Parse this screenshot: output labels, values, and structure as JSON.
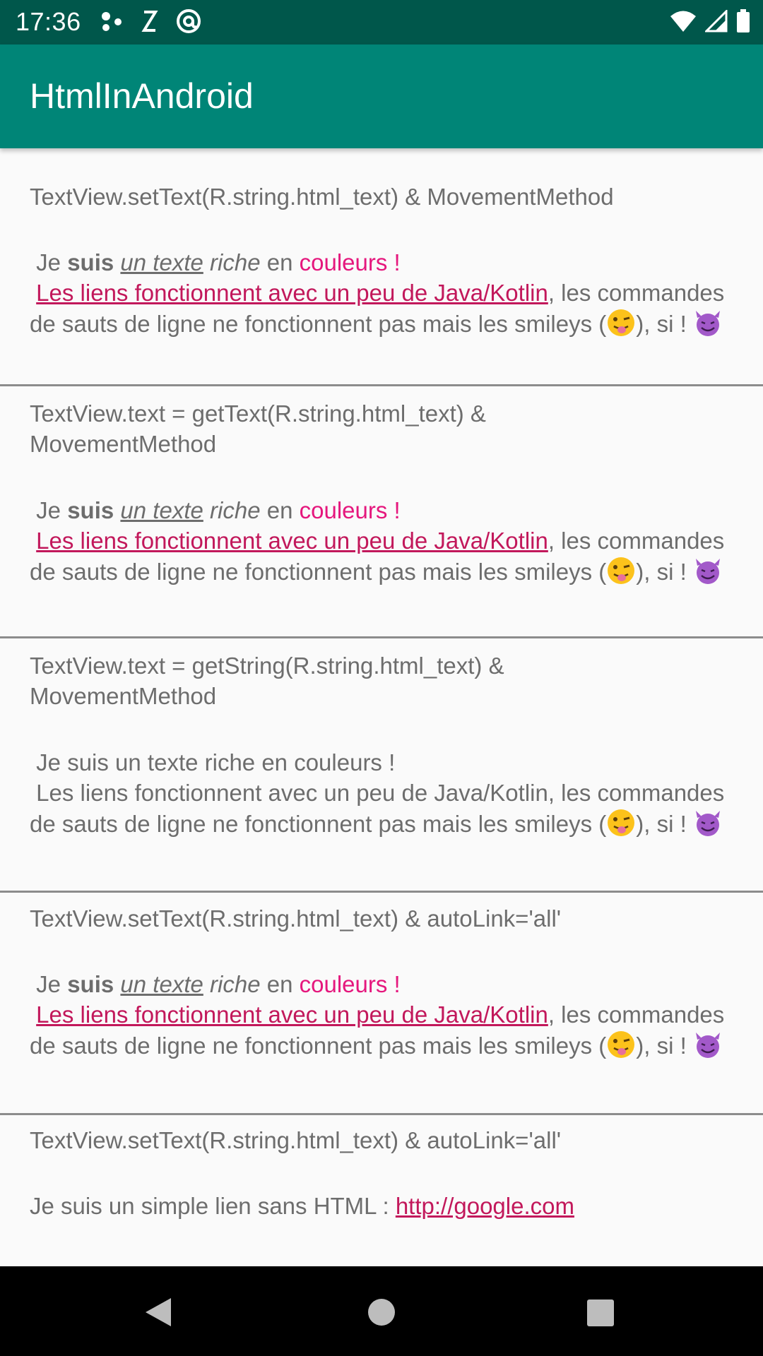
{
  "status_bar": {
    "time": "17:36"
  },
  "app_bar": {
    "title": "HtmlInAndroid"
  },
  "sections": [
    {
      "title": "TextView.setText(R.string.html_text) & MovementMethod",
      "line1": {
        "je": "Je",
        "suis": "suis",
        "un_texte": "un texte",
        "riche": "riche",
        "en": "en",
        "couleurs": "couleurs !"
      },
      "link_text": "Les liens fonctionnent avec un peu de Java/Kotlin",
      "rest": ", les commandes de sauts de ligne ne fonctionnent pas mais les smileys (",
      "tail": "), si ! "
    },
    {
      "title": "TextView.text = getText(R.string.html_text) & MovementMethod",
      "line1": {
        "je": "Je",
        "suis": "suis",
        "un_texte": "un texte",
        "riche": "riche",
        "en": "en",
        "couleurs": "couleurs !"
      },
      "link_text": "Les liens fonctionnent avec un peu de Java/Kotlin",
      "rest": ", les commandes de sauts de ligne ne fonctionnent pas mais les smileys (",
      "tail": "), si ! "
    },
    {
      "title": "TextView.text = getString(R.string.html_text) & MovementMethod",
      "plain_line1": "Je suis un texte riche en couleurs !",
      "plain_line2": "Les liens fonctionnent avec un peu de Java/Kotlin, les commandes de sauts de ligne ne fonctionnent pas mais les smileys (",
      "tail": "), si ! "
    },
    {
      "title": "TextView.setText(R.string.html_text) & autoLink='all'",
      "line1": {
        "je": "Je",
        "suis": "suis",
        "un_texte": "un texte",
        "riche": "riche",
        "en": "en",
        "couleurs": "couleurs !"
      },
      "link_text": "Les liens fonctionnent avec un peu de Java/Kotlin",
      "rest": ", les commandes de sauts de ligne ne fonctionnent pas mais les smileys (",
      "tail": "), si ! "
    },
    {
      "title": "TextView.setText(R.string.html_text) & autoLink='all'",
      "prefix": "Je suis un simple lien sans HTML : ",
      "url": "http://google.com"
    }
  ],
  "colors": {
    "status_bar": "#00574b",
    "app_bar": "#008577",
    "text": "#6d6d6d",
    "accent_pink": "#e5177d",
    "link": "#c2185b"
  },
  "icons": [
    "dots-icon",
    "shuffle-icon",
    "at-icon",
    "wifi-icon",
    "signal-icon",
    "battery-icon",
    "winking-tongue-emoji",
    "smiling-devil-emoji",
    "back-icon",
    "home-icon",
    "recents-icon"
  ]
}
